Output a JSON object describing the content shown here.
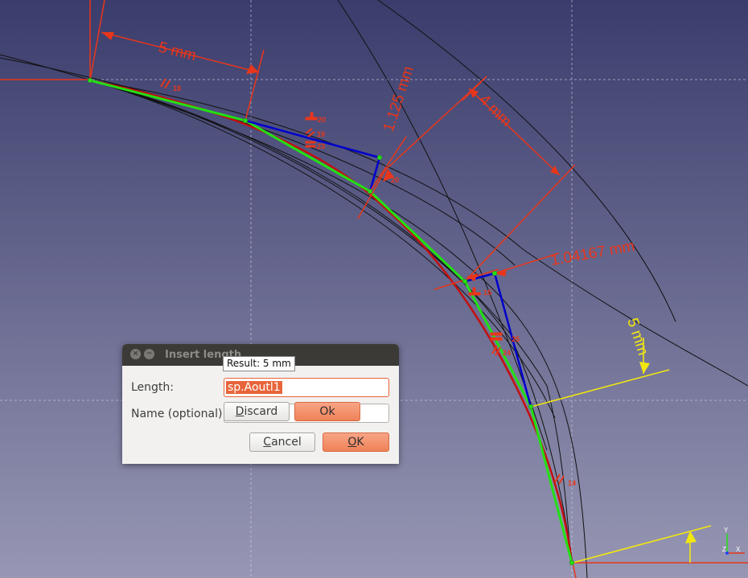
{
  "dimensions": {
    "d1": "5 mm",
    "d2": "1.125 mm",
    "d3": "4 mm",
    "d4": "1.04167 mm",
    "d5": "5 mm"
  },
  "constraint_labels": {
    "c18": "18",
    "c20a": "20",
    "c19": "19",
    "c23": "23",
    "c20b": "20",
    "c15": "15",
    "c25": "25",
    "c24": "24",
    "c14": "14"
  },
  "axis": {
    "y": "Y",
    "z": "Z",
    "x": "X"
  },
  "colors": {
    "bg_top": "#3a3c6c",
    "bg_bottom": "#9797b4",
    "dimension": "#e8361b",
    "construction": "#0000cc",
    "geometry": "#22e014",
    "highlight": "#f2e610"
  },
  "dialog": {
    "title": "Insert length",
    "close_icon": "close-icon",
    "minimize_icon": "minimize-icon",
    "tooltip": "Result: 5 mm",
    "length_label": "Length:",
    "length_value": "sp.Aoutl1",
    "name_label": "Name (optional)",
    "name_value": "",
    "discard_label": "Discard",
    "discard_mnemonic": "D",
    "discard_rest": "iscard",
    "ok_inline_label": "Ok",
    "cancel_mnemonic": "C",
    "cancel_rest": "ancel",
    "ok_mnemonic": "O",
    "ok_rest": "K"
  }
}
